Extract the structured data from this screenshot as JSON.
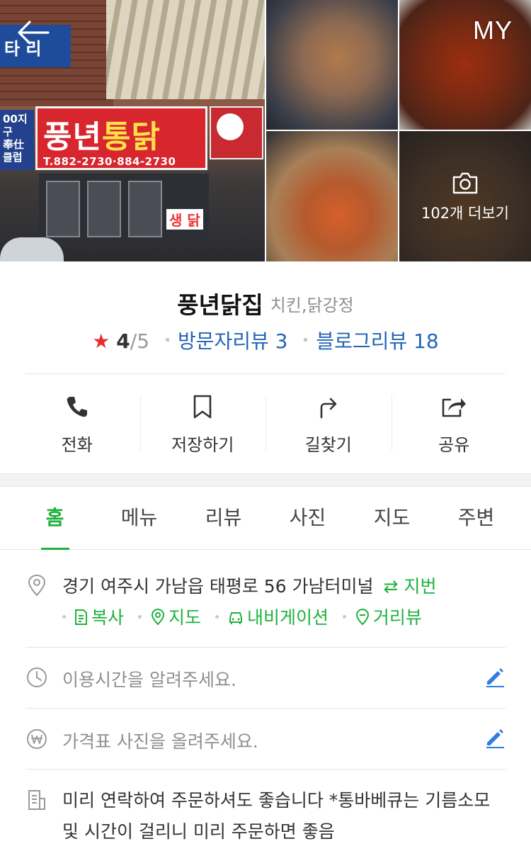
{
  "header": {
    "back_label": "←",
    "my_label": "MY"
  },
  "gallery": {
    "more_photos_label": "102개 더보기",
    "storefront_sign": {
      "name_part1": "풍년",
      "name_part2": "통닭",
      "phone": "T.882-2730·884-2730",
      "left_sign": "00지구\n奉仕\n클럽",
      "blue_sign": "타 리",
      "window_text": "생 닭"
    }
  },
  "place": {
    "name": "풍년닭집",
    "category": "치킨,닭강정",
    "rating_star": "★",
    "rating_value": "4",
    "rating_max": "/5",
    "visitor_reviews": "방문자리뷰 3",
    "blog_reviews": "블로그리뷰 18"
  },
  "actions": [
    {
      "label": "전화",
      "icon": "phone-icon"
    },
    {
      "label": "저장하기",
      "icon": "bookmark-icon"
    },
    {
      "label": "길찾기",
      "icon": "directions-icon"
    },
    {
      "label": "공유",
      "icon": "share-icon"
    }
  ],
  "tabs": [
    {
      "label": "홈",
      "active": true
    },
    {
      "label": "메뉴",
      "active": false
    },
    {
      "label": "리뷰",
      "active": false
    },
    {
      "label": "사진",
      "active": false
    },
    {
      "label": "지도",
      "active": false
    },
    {
      "label": "주변",
      "active": false
    }
  ],
  "info": {
    "address": "경기 여주시 가남읍 태평로 56 가남터미널",
    "jibun_label": "⇄ 지번",
    "address_actions": {
      "copy": "복사",
      "map": "지도",
      "navigation": "내비게이션",
      "street_view": "거리뷰"
    },
    "hours_hint": "이용시간을 알려주세요.",
    "price_hint": "가격표 사진을 올려주세요.",
    "note": "미리 연락하여 주문하셔도 좋습니다 *통바베큐는 기름소모 및 시간이 걸리니 미리 주문하면 좋음"
  },
  "colors": {
    "accent_green": "#1fb23e",
    "link_blue": "#2364b6",
    "star_red": "#e5302f",
    "edit_blue": "#2f7de1"
  }
}
